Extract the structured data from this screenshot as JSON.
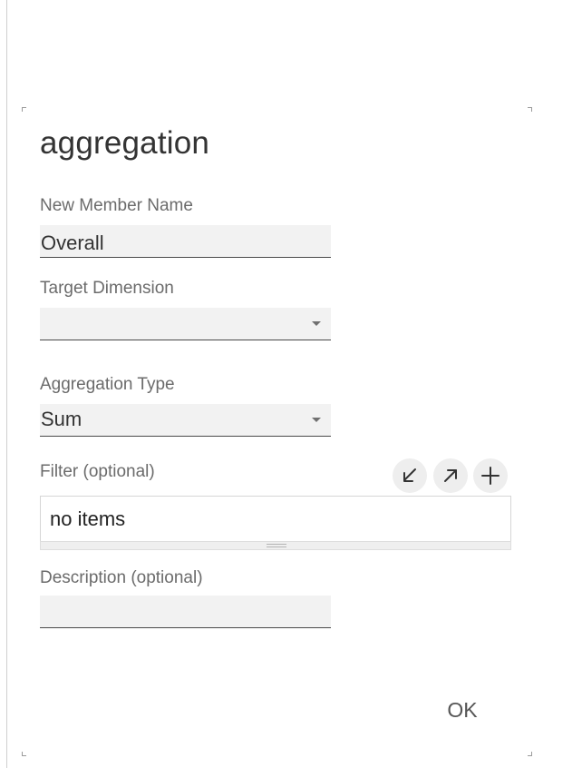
{
  "dialog": {
    "title": "aggregation"
  },
  "fields": {
    "new_member_name": {
      "label": "New Member Name",
      "value": "Overall"
    },
    "target_dimension": {
      "label": "Target Dimension",
      "value": ""
    },
    "aggregation_type": {
      "label": "Aggregation Type",
      "value": "Sum"
    },
    "filter": {
      "label": "Filter (optional)",
      "content": "no items"
    },
    "description": {
      "label": "Description (optional)",
      "value": ""
    }
  },
  "filter_actions": {
    "icons": [
      "collapse-arrow-icon",
      "expand-arrow-icon",
      "plus-icon"
    ]
  },
  "actions": {
    "ok_label": "OK"
  },
  "colors": {
    "field_background": "#f2f2f2",
    "underline": "#4a4a4a",
    "label": "#6b6b6b"
  }
}
